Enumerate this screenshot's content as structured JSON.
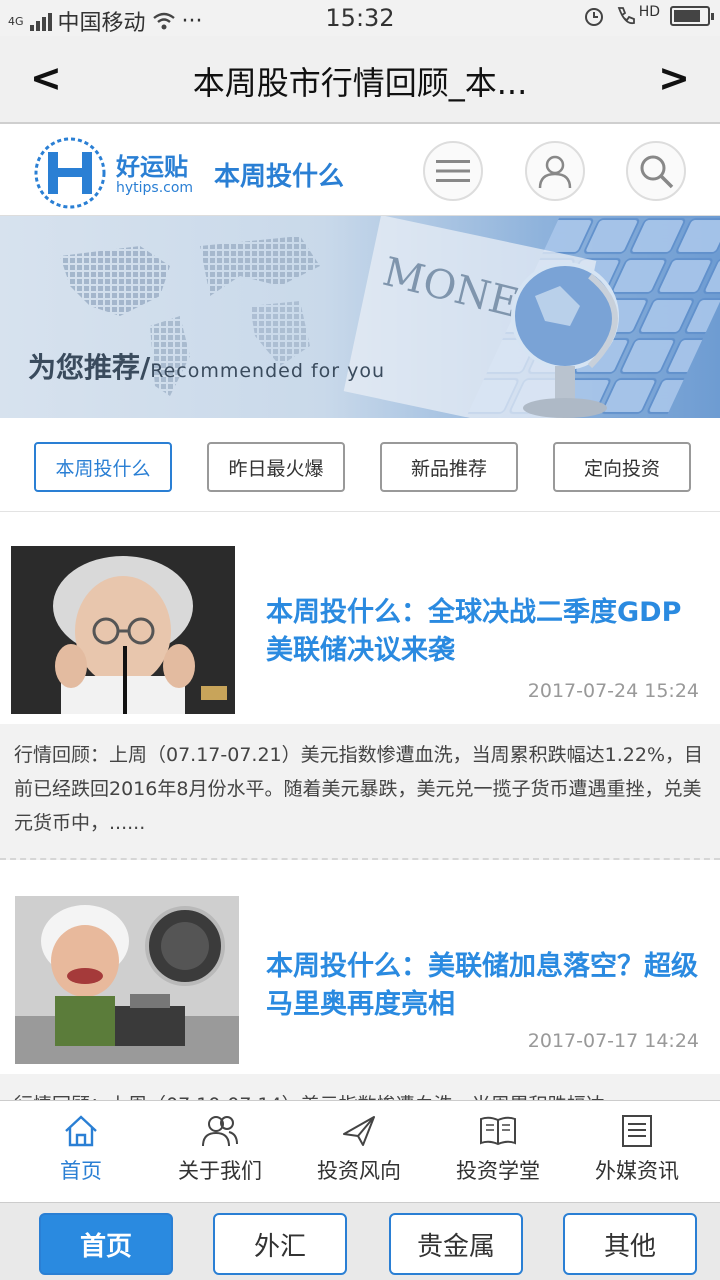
{
  "status_bar": {
    "carrier": "中国移动",
    "network": "4G",
    "time": "15:32",
    "more": "···",
    "hd": "HD",
    "battery_level": 0.8
  },
  "title_bar": {
    "back": "<",
    "forward": ">",
    "title": "本周股市行情回顾_本..."
  },
  "site_header": {
    "logo_name": "好运贴",
    "logo_domain": "hytips.com",
    "section_title": "本周投什么"
  },
  "banner": {
    "caption_cn": "为您推荐/",
    "caption_en": "Recommended for you",
    "image_text": "MONEY"
  },
  "tabs": [
    {
      "label": "本周投什么",
      "active": true
    },
    {
      "label": "昨日最火爆",
      "active": false
    },
    {
      "label": "新品推荐",
      "active": false
    },
    {
      "label": "定向投资",
      "active": false
    }
  ],
  "articles": [
    {
      "title": "本周投什么：全球决战二季度GDP美联储决议来袭",
      "date": "2017-07-24 15:24",
      "summary": "行情回顾：上周（07.17-07.21）美元指数惨遭血洗，当周累积跌幅达1.22%，目前已经跌回2016年8月份水平。随着美元暴跌，美元兑一揽子货币遭遇重挫，兑美元货币中，......"
    },
    {
      "title": "本周投什么：美联储加息落空？超级马里奥再度亮相",
      "date": "2017-07-17 14:24",
      "summary": "行情回顾：上周（07.10-07.14）美元指数惨遭血洗，当周累积跌幅达"
    }
  ],
  "bottom_nav": [
    {
      "label": "首页",
      "icon": "home-icon",
      "active": true
    },
    {
      "label": "关于我们",
      "icon": "people-icon",
      "active": false
    },
    {
      "label": "投资风向",
      "icon": "paper-plane-icon",
      "active": false
    },
    {
      "label": "投资学堂",
      "icon": "book-icon",
      "active": false
    },
    {
      "label": "外媒资讯",
      "icon": "document-icon",
      "active": false
    }
  ],
  "bottom_buttons": [
    {
      "label": "首页",
      "active": true
    },
    {
      "label": "外汇",
      "active": false
    },
    {
      "label": "贵金属",
      "active": false
    },
    {
      "label": "其他",
      "active": false
    }
  ],
  "colors": {
    "accent": "#2a7fd4",
    "title_link": "#2a8ae0"
  }
}
